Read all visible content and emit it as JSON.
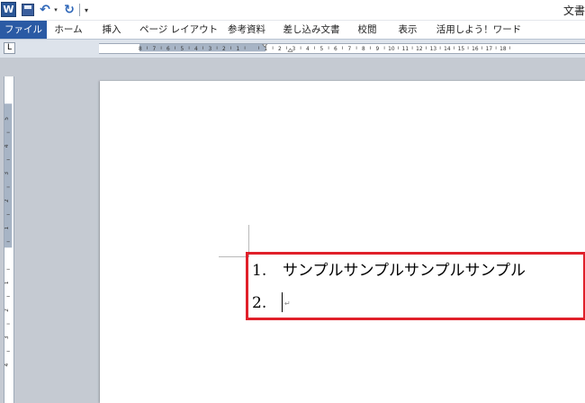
{
  "quick_access": {
    "app_letter": "W",
    "undo_symbol": "↶",
    "undo_dropdown_symbol": "▾",
    "redo_symbol": "↻",
    "customize_symbol": "▾"
  },
  "window": {
    "title": "文書"
  },
  "ribbon": {
    "file_tab": "ファイル",
    "tabs": [
      "ホーム",
      "挿入",
      "ページ レイアウト",
      "参考資料",
      "差し込み文書",
      "校閲",
      "表示",
      "活用しよう！ワード"
    ]
  },
  "ruler": {
    "tab_selector_symbol": "L",
    "horizontal_labels": [
      "8",
      "7",
      "6",
      "5",
      "4",
      "3",
      "2",
      "1",
      "",
      "1",
      "2",
      "3",
      "4",
      "5",
      "6",
      "7",
      "8",
      "9",
      "10",
      "11",
      "12",
      "13",
      "14",
      "15",
      "16",
      "17",
      "18"
    ],
    "vertical_labels": [
      "5",
      "4",
      "3",
      "2",
      "1",
      "",
      "1",
      "2",
      "3",
      "4"
    ]
  },
  "document": {
    "list": [
      {
        "number": "1.",
        "text": "サンプルサンプルサンプルサンプル"
      },
      {
        "number": "2.",
        "text": ""
      }
    ],
    "paragraph_mark": "↵"
  },
  "colors": {
    "file_tab": "#2a5aa4",
    "highlight_border": "#e0202a",
    "ruler_margin": "#a7b4c5",
    "workspace": "#c5cad2"
  }
}
